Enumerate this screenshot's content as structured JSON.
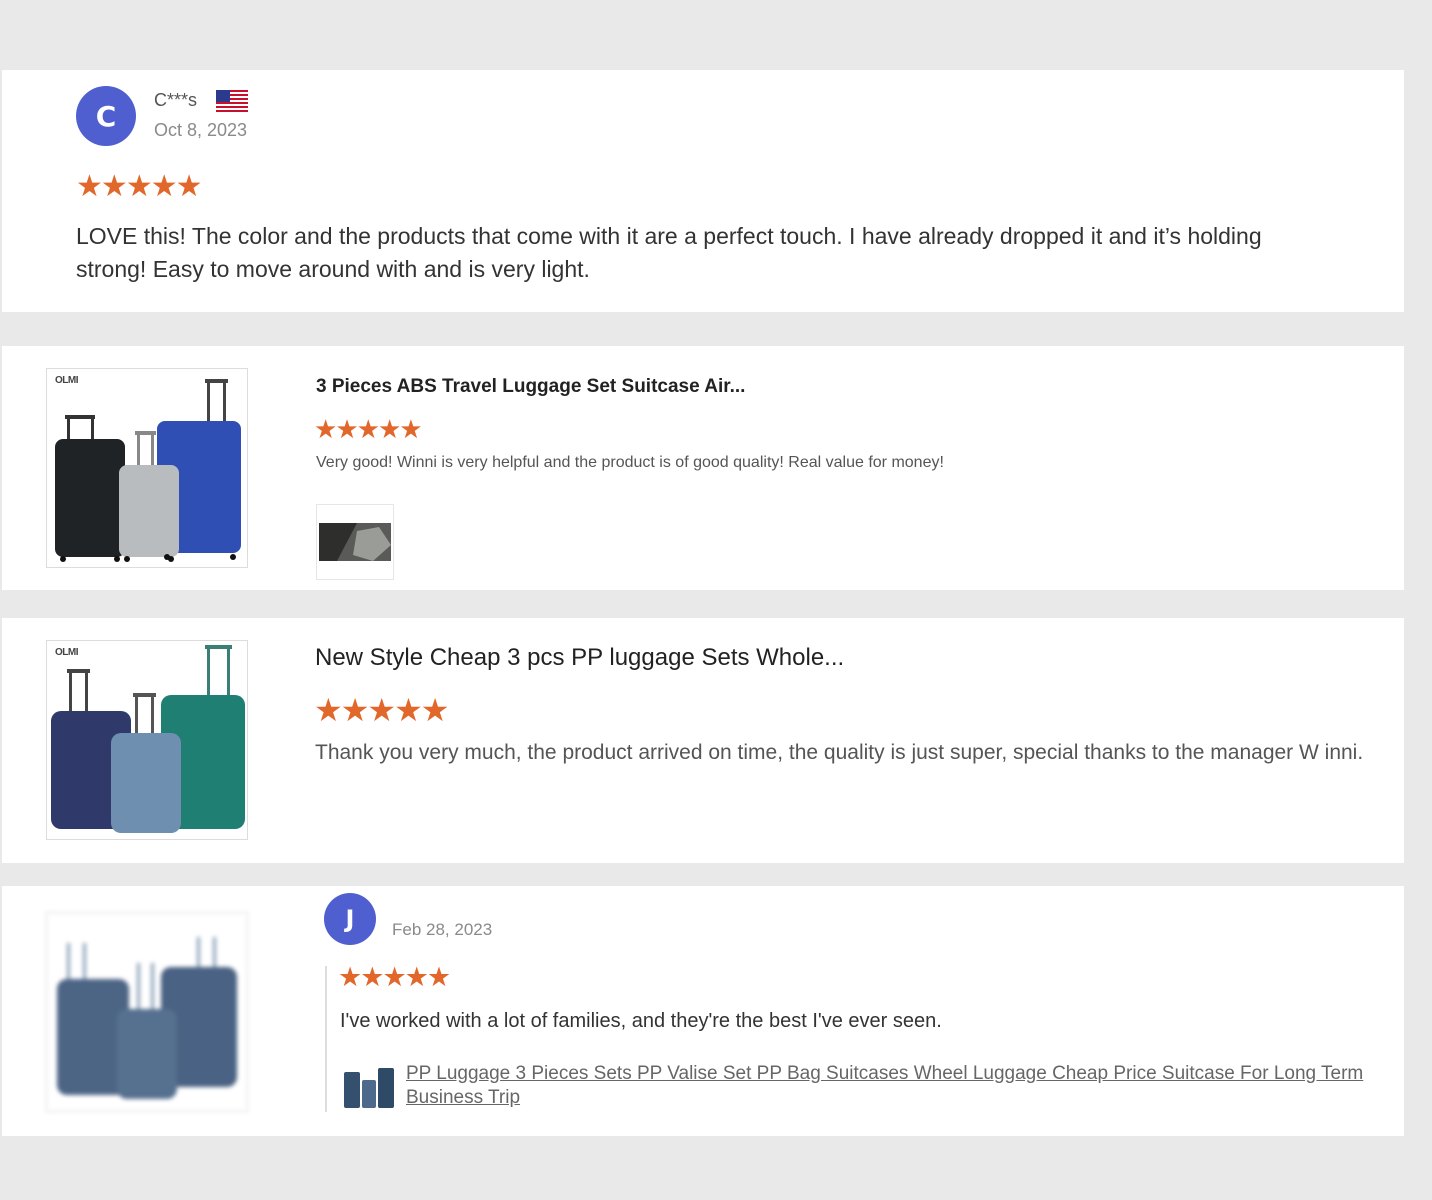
{
  "review1": {
    "avatar_letter": "C",
    "username": "C***s",
    "flag_icon": "us-flag-icon",
    "date": "Oct 8, 2023",
    "rating": 5,
    "text": "LOVE this! The color and the products that come with it are a perfect touch. I have already dropped it and it’s holding strong! Easy to move around with and is very light."
  },
  "review2": {
    "brand": "OLMI",
    "title": "3 Pieces ABS Travel Luggage Set Suitcase Air...",
    "rating": 5,
    "text": "Very good! Winni is very helpful and the product is of good quality! Real value for money!",
    "suitcase_colors": [
      "#1f2326",
      "#b9bcbe",
      "#2f4fb5"
    ]
  },
  "review3": {
    "brand": "OLMI",
    "title": "New Style Cheap 3 pcs PP luggage Sets Whole...",
    "rating": 5,
    "text": "Thank you very much, the product arrived on time, the quality is just super, special thanks to the manager W inni.",
    "suitcase_colors": [
      "#2f3a6b",
      "#6f8fb0",
      "#1f7f72"
    ]
  },
  "review4": {
    "avatar_letter": "J",
    "date": "Feb 28, 2023",
    "rating": 5,
    "text": "I've worked with a lot of families, and they're the best I've ever seen.",
    "product_link": "PP Luggage 3 Pieces Sets PP Valise Set PP Bag Suitcases Wheel Luggage Cheap Price Suitcase For Long Term Business Trip",
    "suitcase_colors": [
      "#4d6585",
      "#56708f",
      "#4a6283"
    ]
  },
  "colors": {
    "star": "#e2672a",
    "avatar": "#4f5fd0",
    "background": "#e9e9e9"
  }
}
